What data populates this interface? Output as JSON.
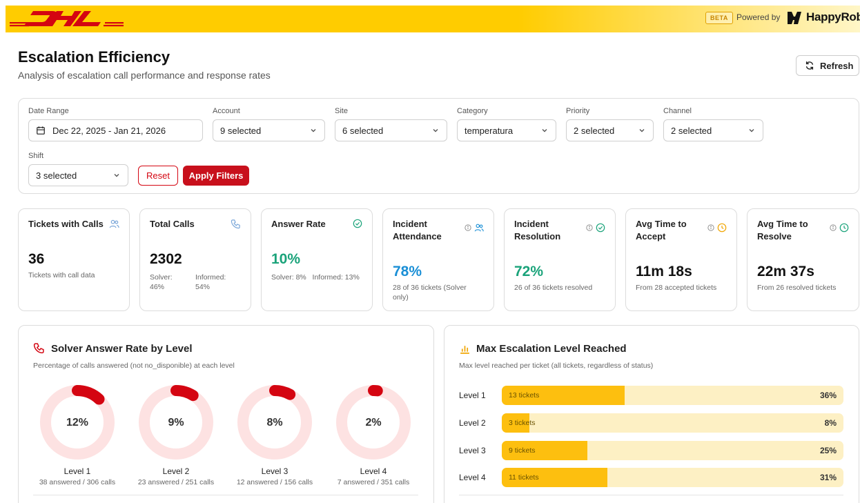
{
  "header": {
    "brand": "DHL",
    "beta": "BETA",
    "powered_by": "Powered by",
    "partner": "HappyRobot"
  },
  "page": {
    "title": "Escalation Efficiency",
    "subtitle": "Analysis of escalation call performance and response rates",
    "refresh_label": "Refresh"
  },
  "filters": {
    "date_range": {
      "label": "Date Range",
      "value": "Dec 22, 2025 - Jan 21, 2026"
    },
    "account": {
      "label": "Account",
      "value": "9 selected"
    },
    "site": {
      "label": "Site",
      "value": "6 selected"
    },
    "category": {
      "label": "Category",
      "value": "temperatura"
    },
    "priority": {
      "label": "Priority",
      "value": "2 selected"
    },
    "channel": {
      "label": "Channel",
      "value": "2 selected"
    },
    "shift": {
      "label": "Shift",
      "value": "3 selected"
    },
    "reset_label": "Reset",
    "apply_label": "Apply Filters"
  },
  "kpis": [
    {
      "title": "Tickets with Calls",
      "value": "36",
      "sub": "Tickets with call data"
    },
    {
      "title": "Total Calls",
      "value": "2302",
      "solver_label": "Solver:",
      "solver_value": "46%",
      "informed_label": "Informed:",
      "informed_value": "54%"
    },
    {
      "title": "Answer Rate",
      "value": "10%",
      "sub": "Solver: 8%   Informed: 13%"
    },
    {
      "title": "Incident Attendance",
      "value": "78%",
      "sub": "28 of 36 tickets (Solver only)"
    },
    {
      "title": "Incident Resolution",
      "value": "72%",
      "sub": "26 of 36 tickets resolved"
    },
    {
      "title": "Avg Time to Accept",
      "value": "11m 18s",
      "sub": "From 28 accepted tickets"
    },
    {
      "title": "Avg Time to Resolve",
      "value": "22m 37s",
      "sub": "From 26 resolved tickets"
    }
  ],
  "colors": {
    "dhl_yellow": "#ffcc00",
    "dhl_red": "#d40511",
    "accent_blue": "#1a8fd6",
    "accent_green": "#1aa37a",
    "donut_track": "#fde2e2",
    "bar_track": "#fdf0c4",
    "bar_fill": "#fdbf0f"
  },
  "solver_panel": {
    "title": "Solver Answer Rate by Level",
    "subtitle": "Percentage of calls answered (not no_disponible) at each level",
    "levels": [
      {
        "name": "Level 1",
        "pct": 12,
        "pct_label": "12%",
        "calls": "38 answered / 306 calls"
      },
      {
        "name": "Level 2",
        "pct": 9,
        "pct_label": "9%",
        "calls": "23 answered / 251 calls"
      },
      {
        "name": "Level 3",
        "pct": 8,
        "pct_label": "8%",
        "calls": "12 answered / 156 calls"
      },
      {
        "name": "Level 4",
        "pct": 2,
        "pct_label": "2%",
        "calls": "7 answered / 351 calls"
      }
    ]
  },
  "escalation_panel": {
    "title": "Max Escalation Level Reached",
    "subtitle": "Max level reached per ticket (all tickets, regardless of status)",
    "levels": [
      {
        "name": "Level 1",
        "tickets": "13 tickets",
        "pct": 36,
        "pct_label": "36%"
      },
      {
        "name": "Level 2",
        "tickets": "3 tickets",
        "pct": 8,
        "pct_label": "8%"
      },
      {
        "name": "Level 3",
        "tickets": "9 tickets",
        "pct": 25,
        "pct_label": "25%"
      },
      {
        "name": "Level 4",
        "tickets": "11 tickets",
        "pct": 31,
        "pct_label": "31%"
      }
    ]
  }
}
